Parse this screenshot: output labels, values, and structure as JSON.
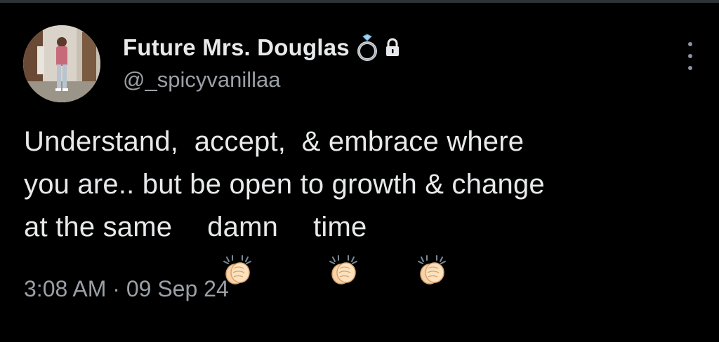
{
  "colors": {
    "background": "#000000",
    "primary_text": "#e7e9ea",
    "secondary_text": "#9aa0a6",
    "divider": "#2f3336"
  },
  "author": {
    "display_name": "Future Mrs. Douglas",
    "name_emoji": "ring-icon",
    "protected_icon": "lock-icon",
    "handle": "@_spicyvanillaa"
  },
  "tweet": {
    "line1": "Understand,  accept,  & embrace where",
    "line2": "you are.. but be open to growth & change",
    "line3_part1": "at the same",
    "line3_part2": "damn",
    "line3_part3": "time",
    "emoji": "clapping-hands-icon"
  },
  "meta": {
    "timestamp": "3:08 AM · 09 Sep 24"
  },
  "more_icon": "more-options-icon"
}
